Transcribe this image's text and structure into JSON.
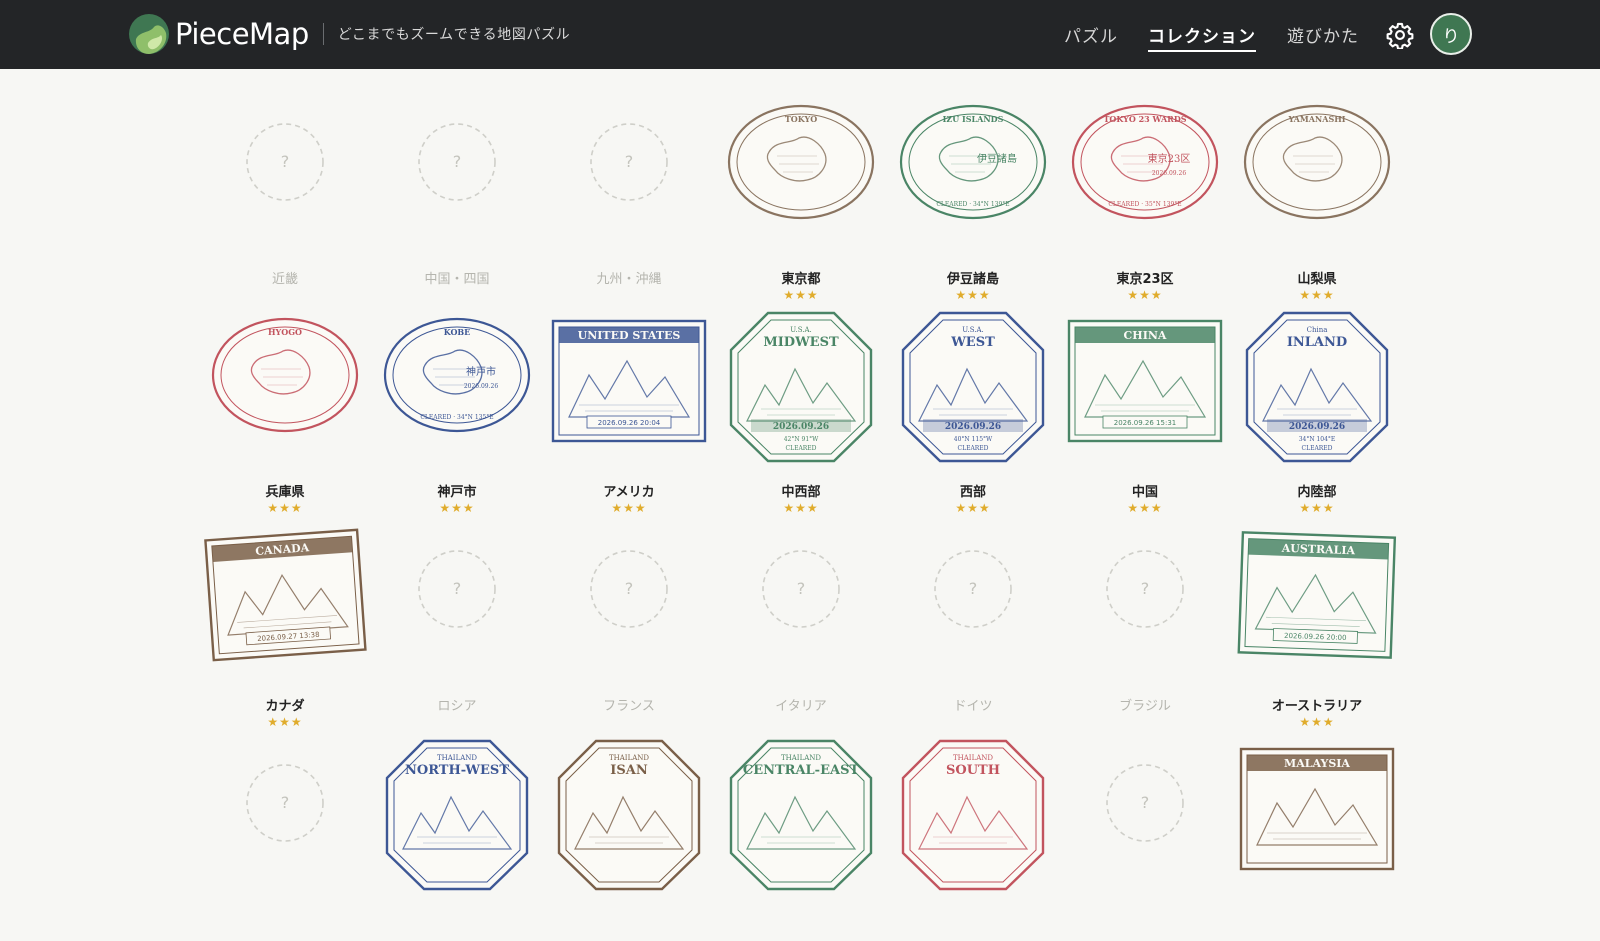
{
  "header": {
    "brand": "PieceMap",
    "tagline": "どこまでもズームできる地図パズル",
    "nav": [
      "パズル",
      "コレクション",
      "遊びかた"
    ],
    "active_nav": "コレクション",
    "avatar_initial": "り",
    "logo_colors": [
      "#3f7752",
      "#8fbf6a",
      "#cfe8a8"
    ]
  },
  "stamps": [
    {
      "name": "近畿",
      "locked": true
    },
    {
      "name": "中国・四国",
      "locked": true
    },
    {
      "name": "九州・沖縄",
      "locked": true
    },
    {
      "name": "東京都",
      "locked": false,
      "shape": "oval",
      "color": "#8a7460",
      "top": "TOKYO",
      "stars": "★★★"
    },
    {
      "name": "伊豆諸島",
      "locked": false,
      "shape": "oval",
      "color": "#4a8566",
      "top": "IZU ISLANDS",
      "center": "伊豆諸島",
      "bottom": "CLEARED · 34°N 139°E",
      "stars": "★★★"
    },
    {
      "name": "東京23区",
      "locked": false,
      "shape": "oval",
      "color": "#c2545e",
      "top": "TOKYO 23 WARDS",
      "center": "東京23区",
      "date": "2026.09.26",
      "bottom": "CLEARED · 35°N 139°E",
      "stars": "★★★"
    },
    {
      "name": "山梨県",
      "locked": false,
      "shape": "oval",
      "color": "#8a7460",
      "top": "YAMANASHI",
      "stars": "★★★"
    },
    {
      "name": "兵庫県",
      "locked": false,
      "shape": "oval",
      "color": "#c2545e",
      "top": "HYOGO",
      "stars": "★★★"
    },
    {
      "name": "神戸市",
      "locked": false,
      "shape": "oval",
      "color": "#3d5795",
      "top": "KOBE",
      "center": "神戸市",
      "date": "2026.09.26",
      "bottom": "CLEARED · 34°N 135°E",
      "stars": "★★★"
    },
    {
      "name": "アメリカ",
      "locked": false,
      "shape": "rect",
      "color": "#3d5795",
      "banner": "UNITED STATES",
      "date": "2026.09.26 20:04",
      "stars": "★★★"
    },
    {
      "name": "中西部",
      "locked": false,
      "shape": "oct",
      "color": "#4a8566",
      "small": "U.S.A.",
      "banner": "MIDWEST",
      "date": "2026.09.26",
      "coord": "42°N 91°W",
      "cleared": "CLEARED",
      "stars": "★★★"
    },
    {
      "name": "西部",
      "locked": false,
      "shape": "oct",
      "color": "#3d5795",
      "small": "U.S.A.",
      "banner": "WEST",
      "date": "2026.09.26",
      "coord": "40°N 115°W",
      "cleared": "CLEARED",
      "stars": "★★★"
    },
    {
      "name": "中国",
      "locked": false,
      "shape": "rect",
      "color": "#4a8566",
      "banner": "CHINA",
      "date": "2026.09.26 15:31",
      "stars": "★★★"
    },
    {
      "name": "内陸部",
      "locked": false,
      "shape": "oct",
      "color": "#3d5795",
      "small": "China",
      "banner": "INLAND",
      "date": "2026.09.26",
      "coord": "34°N 104°E",
      "cleared": "CLEARED",
      "stars": "★★★"
    },
    {
      "name": "カナダ",
      "locked": false,
      "shape": "rect",
      "color": "#7a5f48",
      "banner": "CANADA",
      "date": "2026.09.27 13:38",
      "stars": "★★★",
      "tilt": -4
    },
    {
      "name": "ロシア",
      "locked": true
    },
    {
      "name": "フランス",
      "locked": true
    },
    {
      "name": "イタリア",
      "locked": true
    },
    {
      "name": "ドイツ",
      "locked": true
    },
    {
      "name": "ブラジル",
      "locked": true
    },
    {
      "name": "オーストラリア",
      "locked": false,
      "shape": "rect",
      "color": "#4a8566",
      "banner": "AUSTRALIA",
      "date": "2026.09.26 20:00",
      "stars": "★★★",
      "tilt": 2
    },
    {
      "name": "",
      "locked": true
    },
    {
      "name": "",
      "locked": false,
      "shape": "oct",
      "color": "#3d5795",
      "small": "THAILAND",
      "banner": "NORTH-WEST"
    },
    {
      "name": "",
      "locked": false,
      "shape": "oct",
      "color": "#7a5f48",
      "small": "THAILAND",
      "banner": "ISAN"
    },
    {
      "name": "",
      "locked": false,
      "shape": "oct",
      "color": "#4a8566",
      "small": "THAILAND",
      "banner": "CENTRAL-EAST"
    },
    {
      "name": "",
      "locked": false,
      "shape": "oct",
      "color": "#c2545e",
      "small": "THAILAND",
      "banner": "SOUTH"
    },
    {
      "name": "",
      "locked": true
    },
    {
      "name": "",
      "locked": false,
      "shape": "rect",
      "color": "#7a5f48",
      "banner": "MALAYSIA"
    }
  ],
  "locked_placeholder": "?"
}
